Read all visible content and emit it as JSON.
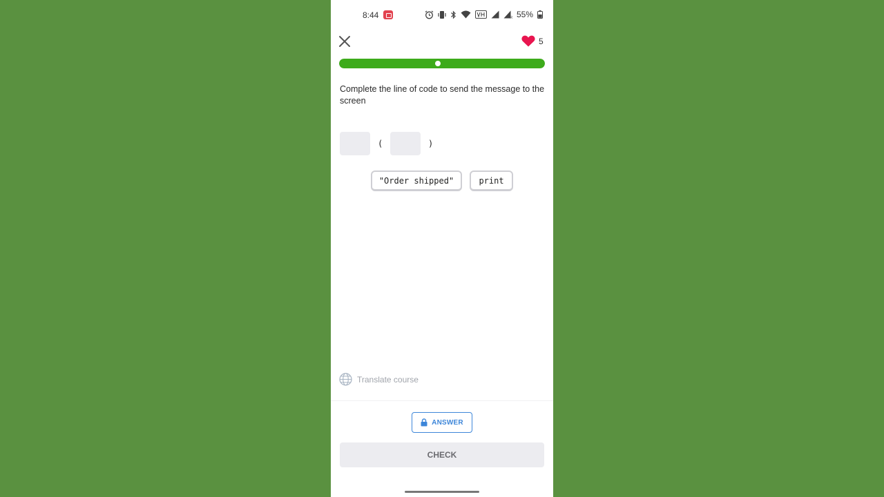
{
  "status_bar": {
    "time": "8:44",
    "battery": "55%",
    "icons": [
      "screen-record-icon",
      "alarm-icon",
      "vibrate-icon",
      "bluetooth-icon",
      "wifi-icon",
      "volte-icon",
      "signal-icon",
      "signal-roaming-icon",
      "battery-icon"
    ]
  },
  "header": {
    "close_icon": "close-icon",
    "hearts_count": "5",
    "heart_color": "#e8154f"
  },
  "progress": {
    "fraction": 0.46,
    "fill_color": "#3dab1b"
  },
  "exercise": {
    "prompt": "Complete the line of code to send the message to the screen",
    "open_paren": "(",
    "close_paren": ")",
    "tokens": [
      "\"Order shipped\"",
      "print"
    ]
  },
  "footer": {
    "translate_label": "Translate course",
    "answer_label": "ANSWER",
    "check_label": "CHECK",
    "accent_color": "#3d86d9"
  }
}
